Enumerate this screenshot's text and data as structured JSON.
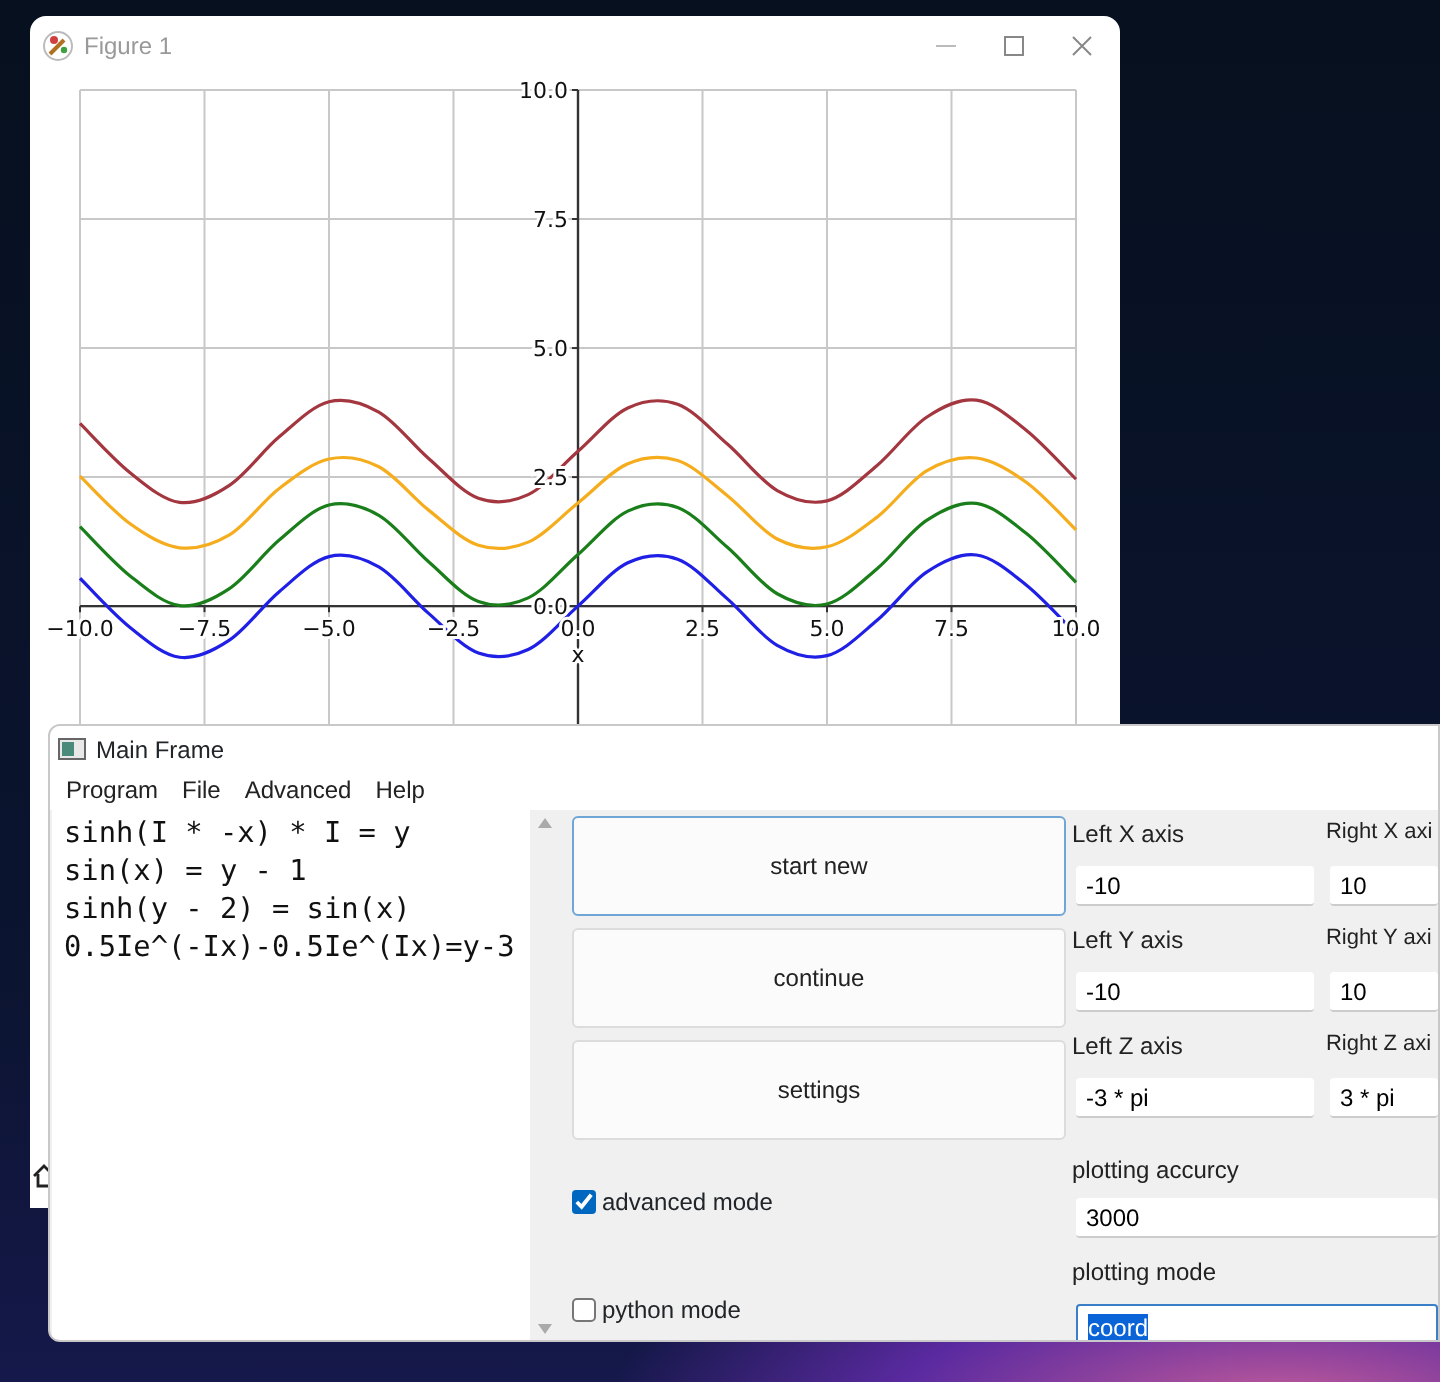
{
  "figure_window": {
    "title": "Figure 1",
    "chart_data": {
      "type": "line",
      "xlabel": "x",
      "x": [
        -10,
        -9,
        -8,
        -7,
        -6,
        -5,
        -4,
        -3,
        -2,
        -1,
        0,
        1,
        2,
        3,
        4,
        5,
        6,
        7,
        8,
        9,
        10
      ],
      "series": [
        {
          "color": "#1f1fe6",
          "values": [
            0.54,
            -0.41,
            -0.99,
            -0.66,
            0.28,
            0.96,
            0.76,
            -0.14,
            -0.91,
            -0.84,
            0,
            0.84,
            0.91,
            0.14,
            -0.76,
            -0.96,
            -0.28,
            0.66,
            0.99,
            0.41,
            -0.54
          ]
        },
        {
          "color": "#1a7f1a",
          "values": [
            1.54,
            0.59,
            0.01,
            0.34,
            1.28,
            1.96,
            1.76,
            0.86,
            0.09,
            0.16,
            1,
            1.84,
            1.91,
            1.14,
            0.24,
            0.04,
            0.72,
            1.66,
            1.99,
            1.41,
            0.46
          ]
        },
        {
          "color": "#f5ad1e",
          "values": [
            2.52,
            1.6,
            1.13,
            1.38,
            2.28,
            2.85,
            2.7,
            1.86,
            1.18,
            1.24,
            2,
            2.76,
            2.82,
            2.14,
            1.3,
            1.15,
            1.72,
            2.62,
            2.87,
            2.4,
            1.48
          ]
        },
        {
          "color": "#a3363f",
          "values": [
            3.54,
            2.59,
            2.01,
            2.34,
            3.28,
            3.96,
            3.76,
            2.86,
            2.09,
            2.16,
            3,
            3.84,
            3.91,
            3.14,
            2.24,
            2.04,
            2.72,
            3.66,
            3.99,
            3.41,
            2.46
          ]
        }
      ],
      "grid": true,
      "xlim": [
        -10,
        10
      ],
      "ylim": [
        -2.4,
        10
      ],
      "xticks": [
        {
          "value": -10,
          "label": "−10.0"
        },
        {
          "value": -7.5,
          "label": "−7.5"
        },
        {
          "value": -5,
          "label": "−5.0"
        },
        {
          "value": -2.5,
          "label": "−2.5"
        },
        {
          "value": 0,
          "label": "0.0"
        },
        {
          "value": 2.5,
          "label": "2.5"
        },
        {
          "value": 5,
          "label": "5.0"
        },
        {
          "value": 7.5,
          "label": "7.5"
        },
        {
          "value": 10,
          "label": "10.0"
        }
      ],
      "yticks": [
        {
          "value": 0,
          "label": "0.0"
        },
        {
          "value": 2.5,
          "label": "2.5"
        },
        {
          "value": 5,
          "label": "5.0"
        },
        {
          "value": 7.5,
          "label": "7.5"
        },
        {
          "value": 10,
          "label": "10.0"
        }
      ]
    }
  },
  "main_window": {
    "title": "Main Frame",
    "menu": [
      "Program",
      "File",
      "Advanced",
      "Help"
    ],
    "editor_lines": [
      "sinh(I * -x) * I = y",
      "sin(x) = y - 1",
      "sinh(y - 2) = sin(x)",
      "0.5Ie^(-Ix)-0.5Ie^(Ix)=y-3"
    ],
    "buttons": [
      {
        "label": "start new",
        "focused": true
      },
      {
        "label": "continue",
        "focused": false
      },
      {
        "label": "settings",
        "focused": false
      }
    ],
    "checkboxes": [
      {
        "label": "advanced mode",
        "checked": true
      },
      {
        "label": "python mode",
        "checked": false
      }
    ],
    "axis_fields": [
      {
        "label": "Left X axis",
        "value": "-10"
      },
      {
        "label": "Right X axi",
        "value": "10"
      },
      {
        "label": "Left Y axis",
        "value": "-10"
      },
      {
        "label": "Right Y axi",
        "value": "10"
      },
      {
        "label": "Left Z axis",
        "value": "-3 * pi"
      },
      {
        "label": "Right Z axi",
        "value": "3 * pi"
      }
    ],
    "accuracy": {
      "label": "plotting accurcy",
      "value": "3000"
    },
    "mode": {
      "label": "plotting mode",
      "value": "coord",
      "text_selected": true
    }
  }
}
